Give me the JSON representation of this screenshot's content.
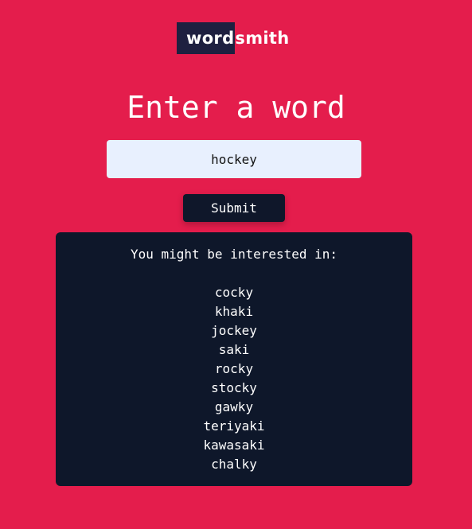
{
  "logo": {
    "highlight": "word",
    "rest": "smith"
  },
  "heading": "Enter a word",
  "input": {
    "value": "hockey"
  },
  "submit_label": "Submit",
  "results": {
    "title": "You might be interested in:",
    "words": [
      "cocky",
      "khaki",
      "jockey",
      "saki",
      "rocky",
      "stocky",
      "gawky",
      "teriyaki",
      "kawasaki",
      "chalky"
    ]
  },
  "colors": {
    "background": "#e41d4c",
    "panel": "#0e172a",
    "logo_box": "#1e2040",
    "input_bg": "#e8f0fe"
  }
}
